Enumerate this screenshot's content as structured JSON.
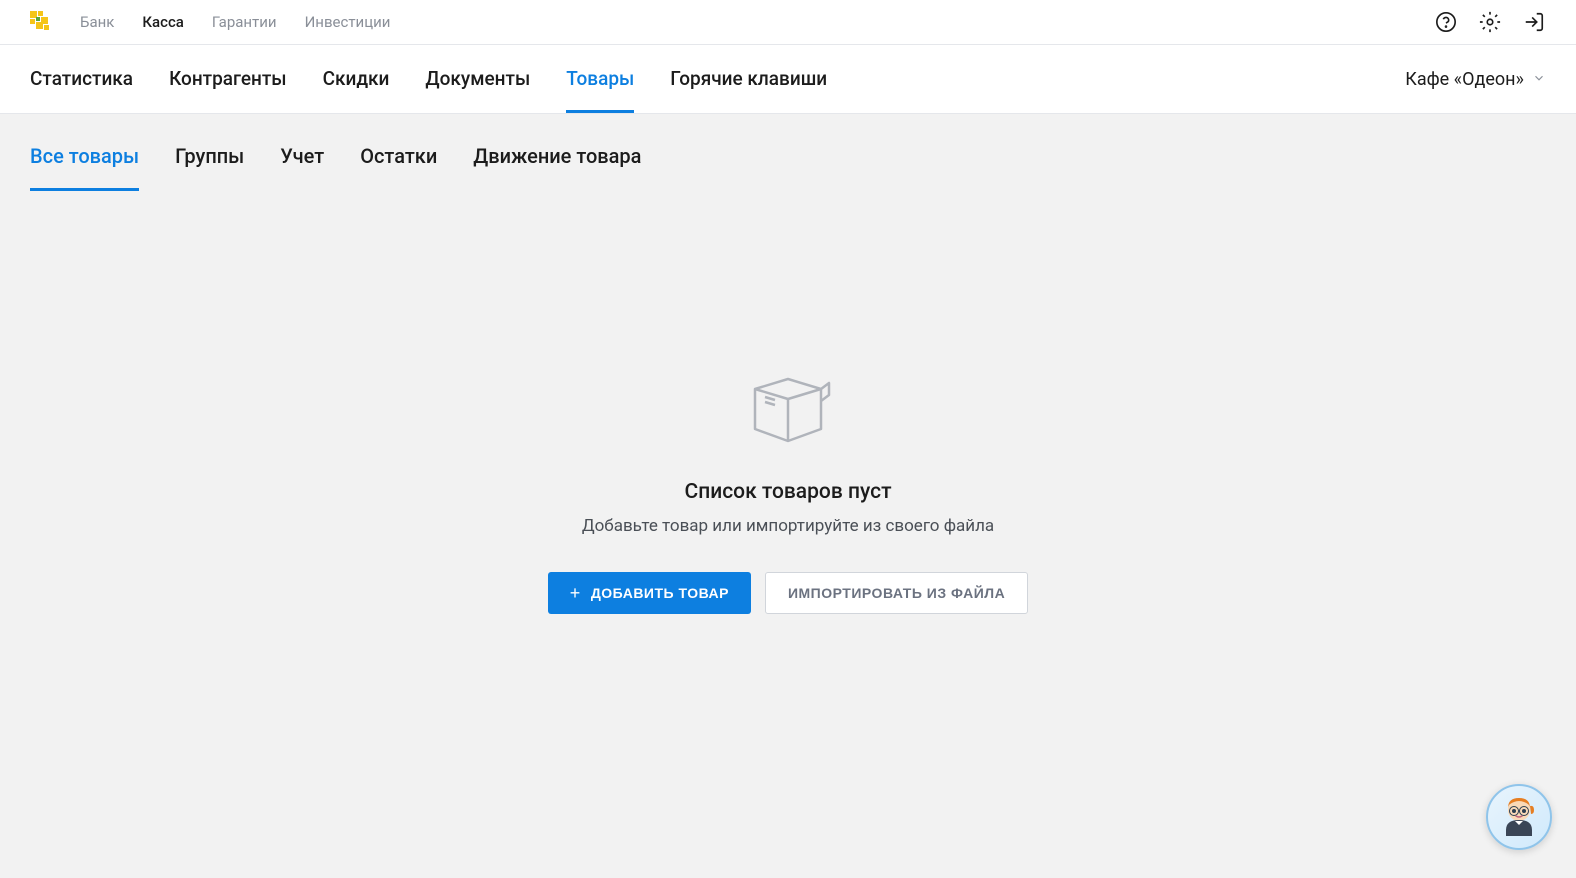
{
  "topNav": {
    "items": [
      {
        "label": "Банк",
        "active": false
      },
      {
        "label": "Касса",
        "active": true
      },
      {
        "label": "Гарантии",
        "active": false
      },
      {
        "label": "Инвестиции",
        "active": false
      }
    ]
  },
  "mainNav": {
    "items": [
      {
        "label": "Статистика",
        "active": false
      },
      {
        "label": "Контрагенты",
        "active": false
      },
      {
        "label": "Скидки",
        "active": false
      },
      {
        "label": "Документы",
        "active": false
      },
      {
        "label": "Товары",
        "active": true
      },
      {
        "label": "Горячие клавиши",
        "active": false
      }
    ],
    "orgName": "Кафе «Одеон»"
  },
  "subNav": {
    "items": [
      {
        "label": "Все товары",
        "active": true
      },
      {
        "label": "Группы",
        "active": false
      },
      {
        "label": "Учет",
        "active": false
      },
      {
        "label": "Остатки",
        "active": false
      },
      {
        "label": "Движение товара",
        "active": false
      }
    ]
  },
  "emptyState": {
    "title": "Список товаров пуст",
    "subtitle": "Добавьте товар или импортируйте из своего файла",
    "addButton": "ДОБАВИТЬ ТОВАР",
    "importButton": "ИМПОРТИРОВАТЬ ИЗ ФАЙЛА"
  },
  "icons": {
    "help": "help-icon",
    "settings": "gear-icon",
    "logout": "logout-icon",
    "box": "box-icon",
    "plus": "plus-icon",
    "chevronDown": "chevron-down-icon"
  }
}
